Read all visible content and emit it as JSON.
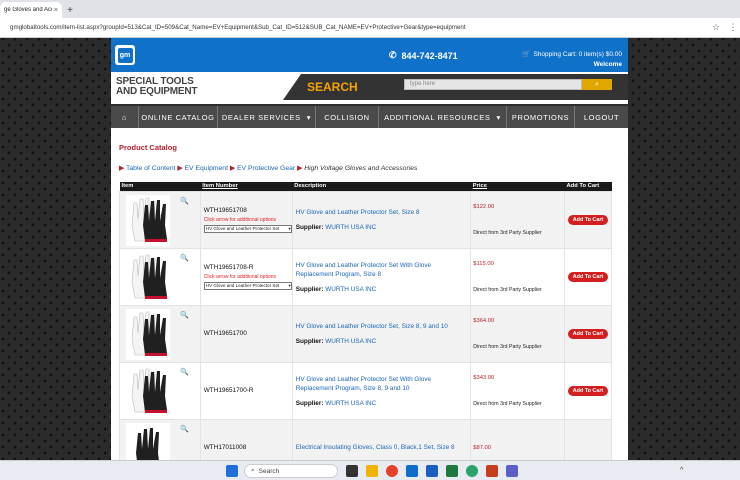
{
  "browser": {
    "tab_title": "ge Gloves and Acces",
    "url": "gmglobaltools.com/item-list.aspx?groupId=513&Cat_ID=509&Cat_Name=EV+Equipment&Sub_Cat_ID=512&SUB_Cat_NAME=EV+Protective+Gear&type=equipment"
  },
  "header": {
    "logo": "gm",
    "phone": "844-742-8471",
    "cart": "Shopping Cart: 0 item(s)  $0.00",
    "welcome": "Welcome",
    "brand_line1": "SPECIAL TOOLS",
    "brand_line2": "AND EQUIPMENT",
    "search_label": "SEARCH",
    "search_placeholder": "type here"
  },
  "nav": {
    "items": [
      "ONLINE CATALOG",
      "DEALER SERVICES",
      "COLLISION",
      "ADDITIONAL RESOURCES",
      "PROMOTIONS",
      "LOGOUT"
    ]
  },
  "page": {
    "title": "Product Catalog",
    "breadcrumb": [
      "Table of Content",
      "EV Equipment",
      "EV Protective Gear",
      "High Voltage Gloves and Accessories"
    ]
  },
  "table": {
    "headers": [
      "Item",
      "Item Number",
      "Description",
      "Price",
      "Add To Cart"
    ],
    "click_arrow": "Click arrow for additional options",
    "supplier_label": "Supplier:",
    "direct": "Direct from 3rd Party Supplier",
    "add_label": "Add To Cart",
    "rows": [
      {
        "item": "WTH19651708",
        "desc": "HV Glove and Leather Protector Set, Size 8",
        "supplier": "WURTH USA INC",
        "price": "$122.00",
        "select": "HV Glove and Leather Protector Set"
      },
      {
        "item": "WTH19651708-R",
        "desc": "HV Glove and Leather Protector Set With Glove Replacement Program, Size 8",
        "supplier": "WURTH USA INC",
        "price": "$115.00",
        "select": "HV Glove and Leather Protector Set"
      },
      {
        "item": "WTH19651700",
        "desc": "HV Glove and Leather Protector Set, Size 8, 9 and 10",
        "supplier": "WURTH USA INC",
        "price": "$364.00"
      },
      {
        "item": "WTH19651700-R",
        "desc": "HV Glove and Leather Protector Set With Glove Replacement Program, Size 8, 9 and 10",
        "supplier": "WURTH USA INC",
        "price": "$343.00"
      },
      {
        "item": "WTH17011008",
        "desc": "Electrical Insulating Gloves, Class 0, Black,1 Set, Size 8",
        "price": "$87.00"
      }
    ]
  },
  "taskbar": {
    "search": "Search"
  }
}
